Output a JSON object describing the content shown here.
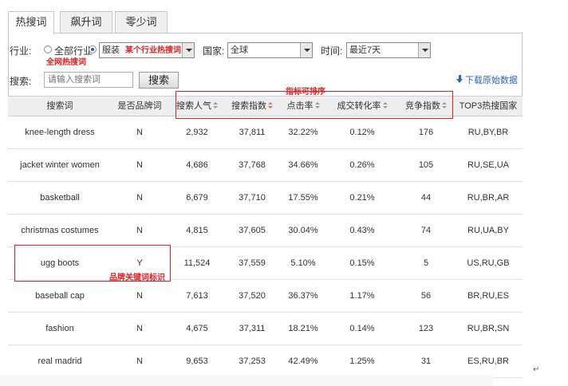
{
  "tabs": [
    {
      "label": "热搜词"
    },
    {
      "label": "飙升词"
    },
    {
      "label": "零少词"
    }
  ],
  "filters": {
    "industry_label": "行业:",
    "all_industries": "全部行业",
    "industry_value": "服装",
    "country_label": "国家:",
    "country_value": "全球",
    "time_label": "时间:",
    "time_value": "最近7天"
  },
  "search": {
    "label": "搜索:",
    "placeholder": "请输入搜索词",
    "button": "搜索",
    "download": "下载原始数据"
  },
  "annotations": {
    "industry_hot": "某个行业热搜词",
    "global_hot": "全网热搜词",
    "sortable": "指标可排序",
    "brand_tag": "品牌关键词标识"
  },
  "table": {
    "headers": [
      "搜索词",
      "是否品牌词",
      "搜索人气",
      "搜索指数",
      "点击率",
      "成交转化率",
      "竞争指数",
      "TOP3热搜国家"
    ],
    "rows": [
      [
        "knee-length dress",
        "N",
        "2,932",
        "37,811",
        "32.22%",
        "0.12%",
        "176",
        "RU,BY,BR"
      ],
      [
        "jacket winter women",
        "N",
        "4,686",
        "37,768",
        "34.66%",
        "0.26%",
        "105",
        "RU,SE,UA"
      ],
      [
        "basketball",
        "N",
        "6,679",
        "37,710",
        "17.55%",
        "0.21%",
        "44",
        "RU,BR,AR"
      ],
      [
        "christmas costumes",
        "N",
        "4,815",
        "37,605",
        "30.04%",
        "0.43%",
        "74",
        "RU,UA,BY"
      ],
      [
        "ugg boots",
        "Y",
        "11,524",
        "37,559",
        "5.10%",
        "0.15%",
        "5",
        "US,RU,GB"
      ],
      [
        "baseball cap",
        "N",
        "7,613",
        "37,520",
        "36.37%",
        "1.17%",
        "56",
        "BR,RU,ES"
      ],
      [
        "fashion",
        "N",
        "4,675",
        "37,311",
        "18.21%",
        "0.14%",
        "123",
        "RU,BR,SN"
      ],
      [
        "real madrid",
        "N",
        "9,653",
        "37,253",
        "42.49%",
        "1.25%",
        "31",
        "ES,RU,BR"
      ]
    ]
  },
  "colors": {
    "annotation_red": "#e02020",
    "link_blue": "#2a66c4",
    "sort_active": "#f07020"
  }
}
